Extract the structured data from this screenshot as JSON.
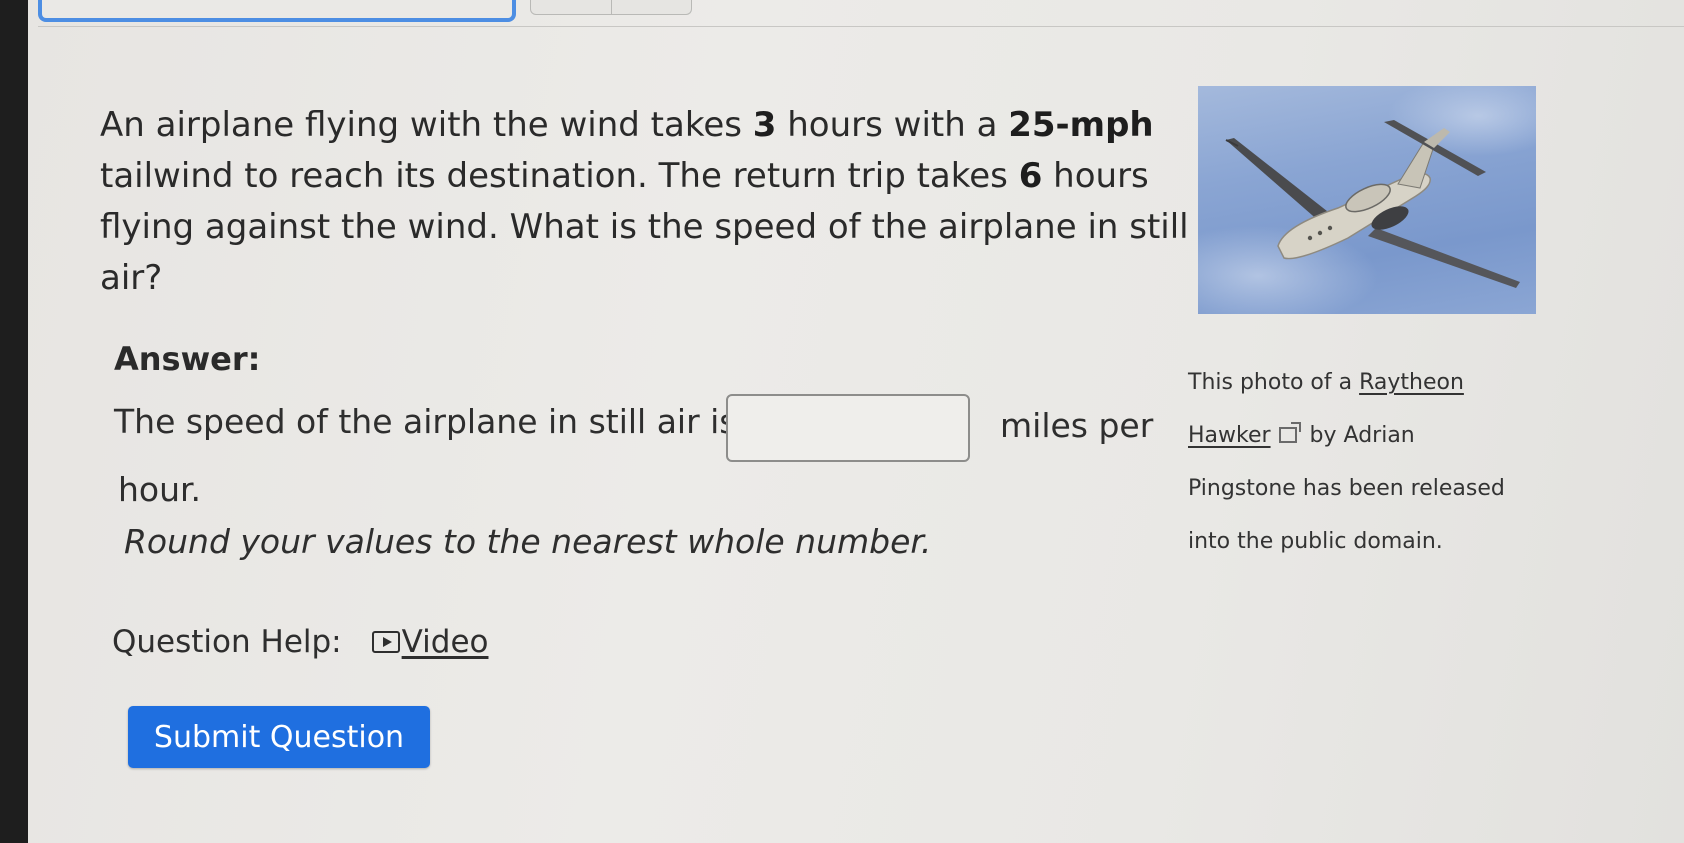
{
  "question": {
    "text_parts": [
      "An airplane flying with the wind takes ",
      "3",
      " hours with a ",
      "25-mph",
      " tailwind to reach its destination.  The return trip takes ",
      "6",
      " hours flying against the wind.  What is the speed of the airplane in still air?"
    ]
  },
  "photo": {
    "credit_prefix": "This photo of a ",
    "credit_link": "Raytheon Hawker",
    "credit_link_line1": "Raytheon",
    "credit_link_line2": "Hawker",
    "credit_by": " by Adrian",
    "credit_line3": "Pingstone has been released",
    "credit_line4": "into the public domain.",
    "external_icon": "external-link-icon"
  },
  "answer": {
    "label": "Answer:",
    "prefix": "The speed of the airplane in still air is",
    "input_value": "",
    "suffix": "miles per",
    "suffix_line2": "hour.",
    "rounding_note": "Round your values to the nearest whole number."
  },
  "help": {
    "label": "Question Help:",
    "video_label": "Video",
    "video_icon": "play-icon"
  },
  "submit": {
    "label": "Submit Question"
  },
  "colors": {
    "submit_bg": "#1f6fe0",
    "active_tab": "#4d8ee3",
    "sky": "#8aa5d3"
  }
}
